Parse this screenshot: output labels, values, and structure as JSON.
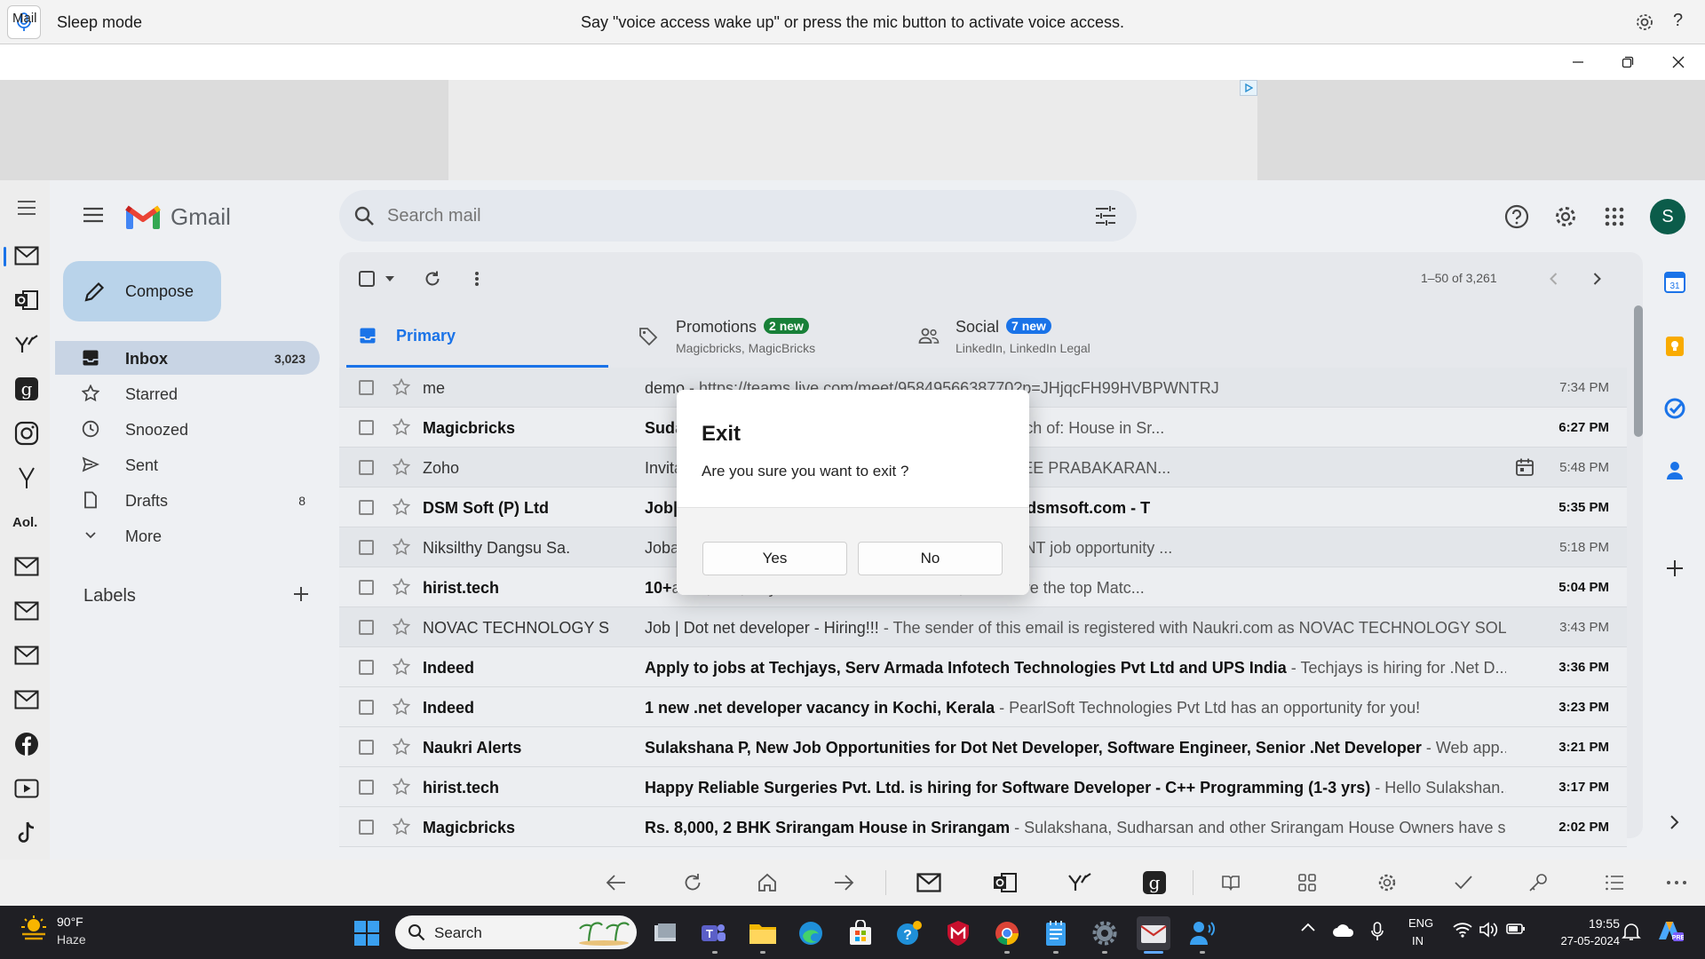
{
  "voice_access": {
    "mode": "Sleep mode",
    "message": "Say \"voice access wake up\" or press the mic button to activate voice access.",
    "help": "?"
  },
  "window": {
    "title": "Mail"
  },
  "gmail": {
    "brand": "Gmail",
    "search_placeholder": "Search mail",
    "avatar_letter": "S"
  },
  "nav": {
    "compose": "Compose",
    "items": [
      {
        "label": "Inbox",
        "count": "3,023"
      },
      {
        "label": "Starred",
        "count": ""
      },
      {
        "label": "Snoozed",
        "count": ""
      },
      {
        "label": "Sent",
        "count": ""
      },
      {
        "label": "Drafts",
        "count": "8"
      },
      {
        "label": "More",
        "count": ""
      }
    ],
    "labels_title": "Labels"
  },
  "toolbar": {
    "pager": "1–50 of 3,261"
  },
  "tabs": [
    {
      "label": "Primary",
      "badge": "",
      "sub": ""
    },
    {
      "label": "Promotions",
      "badge": "2 new",
      "sub": "Magicbricks, MagicBricks"
    },
    {
      "label": "Social",
      "badge": "7 new",
      "sub": "LinkedIn, LinkedIn Legal"
    }
  ],
  "emails": [
    {
      "sender": "me",
      "subject": "demo",
      "snippet": " - https://teams.live.com/meet/9584956638770?p=JHjqcFH99HVBPWNTRJ",
      "time": "7:34 PM"
    },
    {
      "sender": "Magicbricks",
      "subject": "Sud",
      "snippet": "a, Check out Handpicked Houses basis your search of: House in Sr...",
      "time": "6:27 PM"
    },
    {
      "sender": "Zoho",
      "subject": "Invit",
      "snippet": "ay 27 2024, 05:50 PM - 06:20 PM IST. - ANJUSREE PRABAKARAN...",
      "time": "5:48 PM"
    },
    {
      "sender": "DSM Soft (P) Ltd",
      "subject": "Job",
      "snippet": "|| Trichy (WFO) || Walkin || sudharsanpetric.d@dsmsoft.com - T",
      "time": "5:35 PM"
    },
    {
      "sender": "Niksilthy Dangsu Sa.",
      "subject": "Job",
      "snippet": "ai - Dear SULAKSHANA P, We have a PERMANENT job opportunity ...",
      "time": "5:18 PM"
    },
    {
      "sender": "hirist.tech",
      "subject": "10+",
      "snippet": "azon, Ola, Paytm etc - Hello Sulakshana, Below are the top Matc...",
      "time": "5:04 PM"
    },
    {
      "sender": "NOVAC TECHNOLOGY SO.",
      "subject": "Job | Dot net developer - Hiring!!!",
      "snippet": " - The sender of this email is registered with Naukri.com as NOVAC TECHNOLOGY SOL...",
      "time": "3:43 PM"
    },
    {
      "sender": "Indeed",
      "subject": "Apply to jobs at Techjays, Serv Armada Infotech Technologies Pvt Ltd and UPS India",
      "snippet": " - Techjays is hiring for .Net D...",
      "time": "3:36 PM"
    },
    {
      "sender": "Indeed",
      "subject": "1 new .net developer vacancy in Kochi, Kerala",
      "snippet": " - PearlSoft Technologies Pvt Ltd has an opportunity for you!",
      "time": "3:23 PM"
    },
    {
      "sender": "Naukri Alerts",
      "subject": "Sulakshana P, New Job Opportunities for Dot Net Developer, Software Engineer, Senior .Net Developer",
      "snippet": " - Web app...",
      "time": "3:21 PM"
    },
    {
      "sender": "hirist.tech",
      "subject": "Happy Reliable Surgeries Pvt. Ltd. is hiring for Software Developer - C++ Programming (1-3 yrs)",
      "snippet": " - Hello Sulakshan...",
      "time": "3:17 PM"
    },
    {
      "sender": "Magicbricks",
      "subject": "Rs. 8,000, 2 BHK Srirangam House in Srirangam",
      "snippet": " - Sulakshana, Sudharsan and other Srirangam House Owners have s...",
      "time": "2:02 PM"
    }
  ],
  "dialog": {
    "title": "Exit",
    "message": "Are you sure you want to exit ?",
    "yes": "Yes",
    "no": "No"
  },
  "taskbar": {
    "weather_temp": "90°F",
    "weather_desc": "Haze",
    "search_label": "Search",
    "lang_line1": "ENG",
    "lang_line2": "IN",
    "time": "19:55",
    "date": "27-05-2024"
  },
  "colors": {
    "accent": "#1a73e8",
    "promotions_badge": "#188038",
    "social_badge": "#1a73e8",
    "avatar": "#0b5c4a"
  }
}
